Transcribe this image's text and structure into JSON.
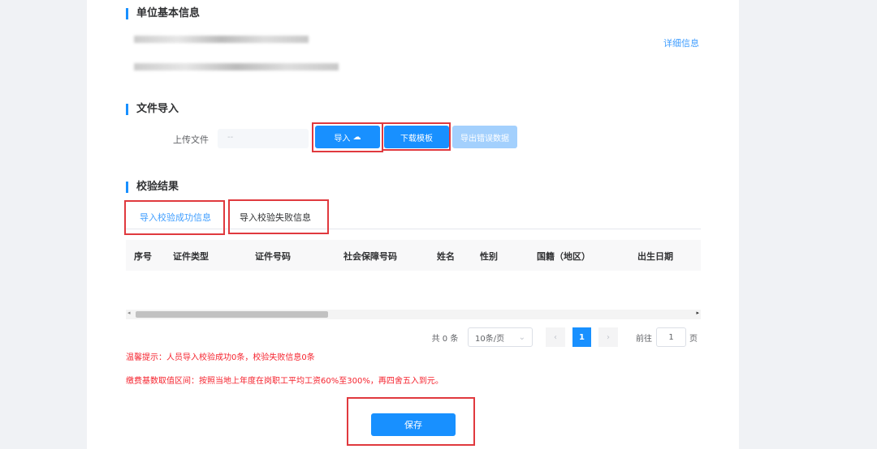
{
  "unit_info": {
    "title": "单位基本信息",
    "detail_link": "详细信息"
  },
  "file_import": {
    "title": "文件导入",
    "upload_label": "上传文件",
    "upload_placeholder": "--",
    "import_button": "导入",
    "download_template_button": "下载模板",
    "export_errors_button": "导出错误数据"
  },
  "validation": {
    "title": "校验结果",
    "tabs": [
      {
        "label": "导入校验成功信息",
        "active": true
      },
      {
        "label": "导入校验失败信息",
        "active": false
      }
    ],
    "columns": [
      "序号",
      "证件类型",
      "证件号码",
      "社会保障号码",
      "姓名",
      "性别",
      "国籍（地区）",
      "出生日期"
    ]
  },
  "pagination": {
    "total": "共 0 条",
    "page_size": "10条/页",
    "current_page": "1",
    "goto_label": "前往",
    "goto_value": "1",
    "page_suffix": "页"
  },
  "notices": [
    "温馨提示：人员导入校验成功0条，校验失败信息0条",
    "缴费基数取值区间：按照当地上年度在岗职工平均工资60%至300%，再四舍五入到元。"
  ],
  "save_button": "保存",
  "colors": {
    "primary": "#1890ff",
    "warning": "#f5222d",
    "highlight": "#e0393e"
  }
}
